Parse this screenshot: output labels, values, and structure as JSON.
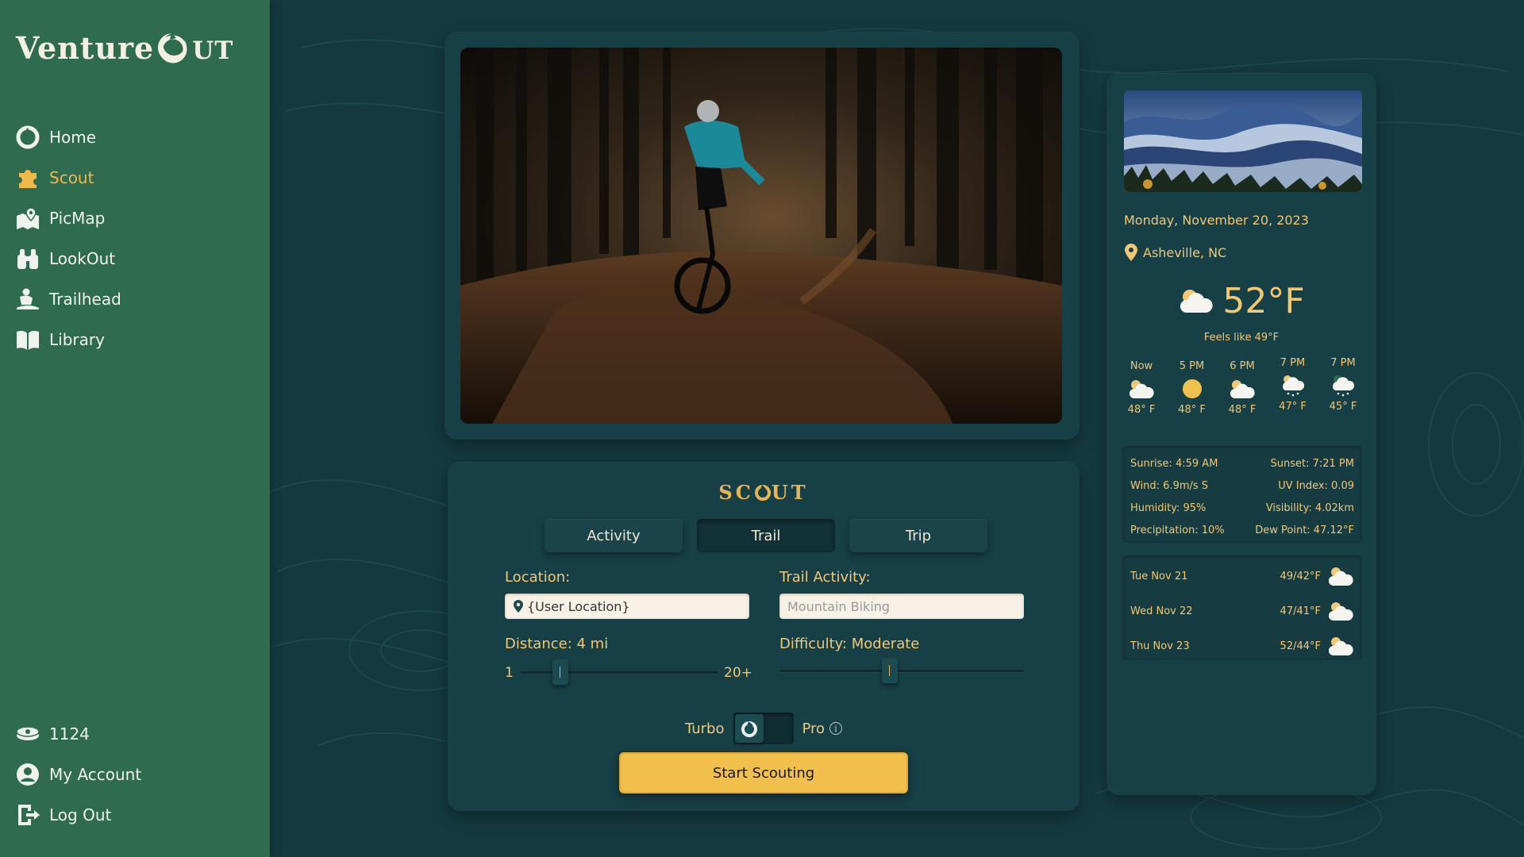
{
  "app": {
    "name_main": "Venture",
    "name_tail": "ut"
  },
  "sidebar": {
    "items": [
      {
        "label": "Home",
        "icon": "moon-icon"
      },
      {
        "label": "Scout",
        "icon": "puzzle-icon",
        "active": true
      },
      {
        "label": "PicMap",
        "icon": "map-pin-icon"
      },
      {
        "label": "LookOut",
        "icon": "binoculars-icon"
      },
      {
        "label": "Trailhead",
        "icon": "hiker-icon"
      },
      {
        "label": "Library",
        "icon": "book-icon"
      }
    ],
    "bottom": {
      "coins": "1124",
      "account": "My Account",
      "logout": "Log Out"
    }
  },
  "scout": {
    "title": "SC",
    "title_tail": "UT",
    "tabs": [
      "Activity",
      "Trail",
      "Trip"
    ],
    "active_tab": "Trail",
    "location_label": "Location:",
    "location_value": "{User Location}",
    "activity_label": "Trail Activity:",
    "activity_placeholder": "Mountain Biking",
    "distance_label": "Distance: 4 mi",
    "distance_min": "1",
    "distance_max": "20+",
    "distance_level": 0.2,
    "difficulty_label": "Difficulty: Moderate",
    "difficulty_level": 0.45,
    "turbo_label": "Turbo",
    "pro_label": "Pro",
    "info_glyph": "i",
    "start_label": "Start Scouting"
  },
  "weather": {
    "date": "Monday, November 20, 2023",
    "location": "Asheville, NC",
    "temp": "52°F",
    "feels": "Feels like 49°F",
    "hourly": [
      {
        "time": "Now",
        "icon": "partly-cloudy-icon",
        "temp": "48° F"
      },
      {
        "time": "5 PM",
        "icon": "sun-icon",
        "temp": "48° F"
      },
      {
        "time": "6 PM",
        "icon": "partly-cloudy-icon",
        "temp": "48° F"
      },
      {
        "time": "7 PM",
        "icon": "rain-icon",
        "temp": "47° F"
      },
      {
        "time": "7 PM",
        "icon": "rain-icon",
        "temp": "45° F"
      }
    ],
    "details": [
      [
        "Sunrise: 4:59 AM",
        "Sunset: 7:21 PM"
      ],
      [
        "Wind: 6.9m/s S",
        "UV Index: 0.09"
      ],
      [
        "Humidity: 95%",
        "Visibility: 4.02km"
      ],
      [
        "Precipitation: 10%",
        "Dew Point: 47.12°F"
      ]
    ],
    "forecast": [
      {
        "day": "Tue Nov 21",
        "temp": "49/42°F"
      },
      {
        "day": "Wed Nov 22",
        "temp": "47/41°F"
      },
      {
        "day": "Thu Nov 23",
        "temp": "52/44°F"
      }
    ]
  },
  "colors": {
    "accent": "#f1c874",
    "sidebar": "#2f6b4f",
    "background": "#143a40",
    "button": "#f0bf4c"
  }
}
